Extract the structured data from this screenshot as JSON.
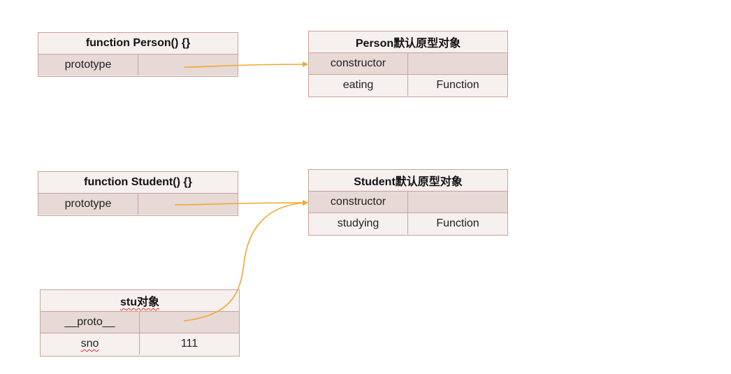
{
  "person_fn": {
    "title": "function Person() {}",
    "rows": [
      {
        "key": "prototype",
        "value": ""
      }
    ]
  },
  "person_proto": {
    "title": "Person默认原型对象",
    "rows": [
      {
        "key": "constructor",
        "value": ""
      },
      {
        "key": "eating",
        "value": "Function"
      }
    ]
  },
  "student_fn": {
    "title": "function Student() {}",
    "rows": [
      {
        "key": "prototype",
        "value": ""
      }
    ]
  },
  "student_proto": {
    "title": "Student默认原型对象",
    "rows": [
      {
        "key": "constructor",
        "value": ""
      },
      {
        "key": "studying",
        "value": "Function"
      }
    ]
  },
  "stu_obj": {
    "title": "stu对象",
    "rows": [
      {
        "key": "__proto__",
        "value": ""
      },
      {
        "key": "sno",
        "value": "111"
      }
    ]
  },
  "colors": {
    "arrow": "#f0a830",
    "border": "#c9a39b",
    "cell_dark": "#e6d9d6",
    "cell_light": "#f6f0ef"
  }
}
